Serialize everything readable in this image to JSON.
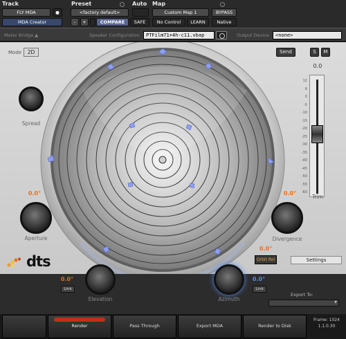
{
  "header": {
    "track_label": "Track",
    "preset_label": "Preset",
    "auto_label": "Auto",
    "map_label": "Map",
    "track_name": "FLY MDA",
    "track_toggle": "●",
    "plugin_name": "MDA Creator",
    "preset_value": "<factory default>",
    "minus_label": "-",
    "plus_label": "+",
    "compare_label": "COMPARE",
    "safe_label": "SAFE",
    "map_value": "Custom Map 1",
    "no_control_label": "No Control",
    "learn_label": "LEARN",
    "bypass_label": "BYPASS",
    "native_label": "Native"
  },
  "bridge": {
    "meter_bridge_label": "Meter Bridge ▲",
    "speaker_config_label": "Speaker Configuration",
    "speaker_config_value": "PTFilm71+4h-c11.vbap",
    "output_device_label": "Output Device",
    "output_device_value": "<none>"
  },
  "panel": {
    "mode_label": "Mode",
    "mode_value": "2D",
    "send_label": "Send",
    "s_label": "S",
    "m_label": "M",
    "meter_value": "0.0",
    "meter_ticks": [
      "12",
      "6",
      "0",
      "-5",
      "-10",
      "-15",
      "-20",
      "-25",
      "-30",
      "-35",
      "-40",
      "-45",
      "-50",
      "-55",
      "-60"
    ],
    "trim_label": "Trim",
    "spread_label": "Spread",
    "aperture_value": "0.0°",
    "aperture_label": "Aperture",
    "divergence_value": "0.0°",
    "divergence_label": "Divergence",
    "orbit_value": "0.0°",
    "orbit_label": "Orbit Rol",
    "settings_label": "Settings",
    "logo_text": "dts",
    "elevation_value": "0.0°",
    "elevation_link": "Link",
    "elevation_label": "Elevation",
    "azimuth_value": "0.0°",
    "azimuth_link": "Link",
    "azimuth_label": "Azimuth",
    "export_to_label": "Export To:"
  },
  "footer": {
    "render_label": "Render",
    "pass_through_label": "Pass Through",
    "export_mda_label": "Export MDA",
    "render_to_disk_label": "Render to Disk",
    "frame_label": "Frame: 1024",
    "version_label": "1.1.0.30"
  },
  "colors": {
    "speaker_marker": "#8f9ff0",
    "value_orange": "#e8701c",
    "value_blue": "#5a8ae8",
    "record_red": "#c03018"
  }
}
